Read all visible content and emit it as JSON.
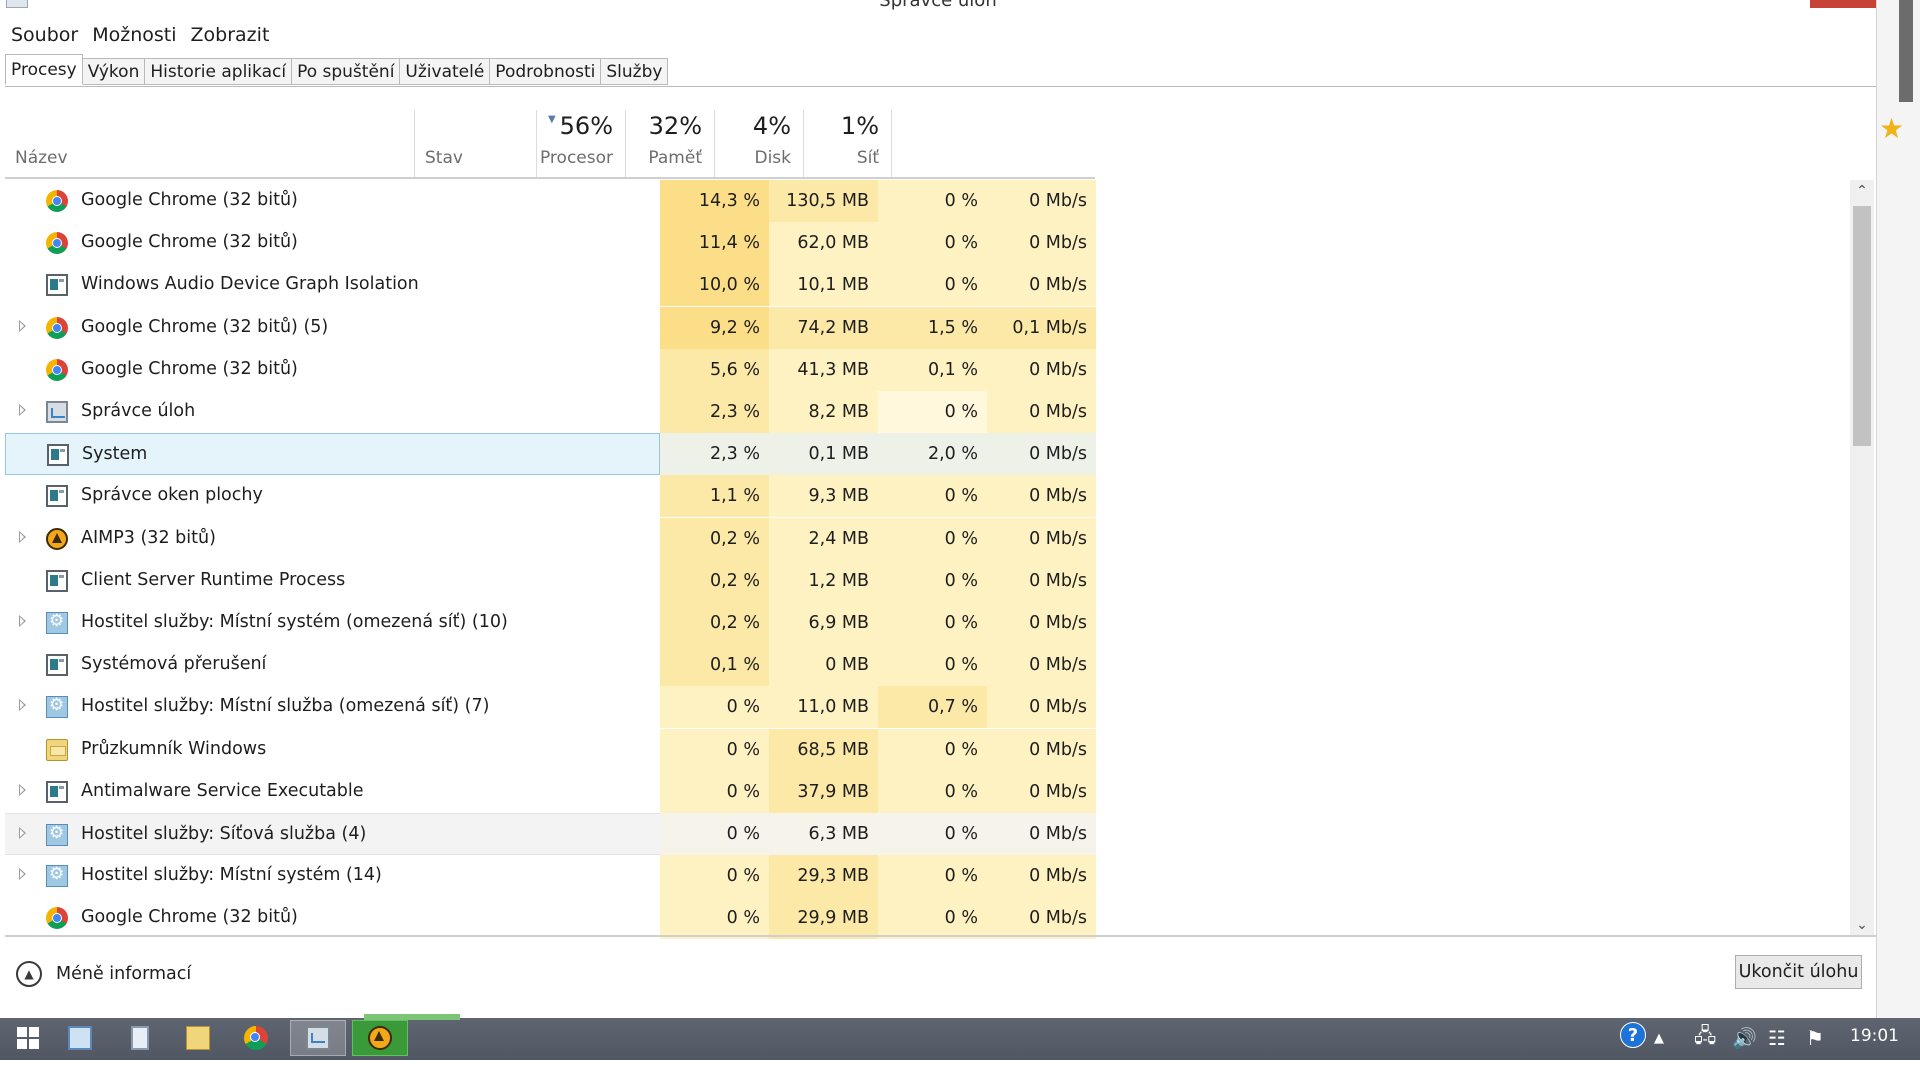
{
  "window": {
    "title": "Správce úloh"
  },
  "menu": [
    "Soubor",
    "Možnosti",
    "Zobrazit"
  ],
  "tabs": [
    {
      "label": "Procesy",
      "active": true
    },
    {
      "label": "Výkon"
    },
    {
      "label": "Historie aplikací"
    },
    {
      "label": "Po spuštění"
    },
    {
      "label": "Uživatelé"
    },
    {
      "label": "Podrobnosti"
    },
    {
      "label": "Služby"
    }
  ],
  "columns": {
    "name": {
      "label": "Název"
    },
    "status": {
      "label": "Stav"
    },
    "cpu": {
      "label": "Procesor",
      "total": "56%"
    },
    "memory": {
      "label": "Paměť",
      "total": "32%"
    },
    "disk": {
      "label": "Disk",
      "total": "4%"
    },
    "network": {
      "label": "Síť",
      "total": "1%"
    }
  },
  "heat_colors": {
    "strong": "#fdde88",
    "medium": "#fce9a7",
    "light": "#fff2c2",
    "none": "#fff8dc",
    "selected": "#eef1e8",
    "hover": "#f5f3ea"
  },
  "processes": [
    {
      "name": "Google Chrome (32 bitů)",
      "icon": "chrome-icon",
      "expandable": false,
      "cpu": "14,3 %",
      "memory": "130,5 MB",
      "disk": "0 %",
      "network": "0 Mb/s",
      "heat": [
        "strong",
        "medium",
        "light",
        "light"
      ]
    },
    {
      "name": "Google Chrome (32 bitů)",
      "icon": "chrome-icon",
      "expandable": false,
      "cpu": "11,4 %",
      "memory": "62,0 MB",
      "disk": "0 %",
      "network": "0 Mb/s",
      "heat": [
        "strong",
        "light",
        "light",
        "light"
      ]
    },
    {
      "name": "Windows Audio Device Graph Isolation",
      "icon": "window-app-icon",
      "expandable": false,
      "cpu": "10,0 %",
      "memory": "10,1 MB",
      "disk": "0 %",
      "network": "0 Mb/s",
      "heat": [
        "strong",
        "light",
        "light",
        "light"
      ]
    },
    {
      "name": "Google Chrome (32 bitů) (5)",
      "icon": "chrome-icon",
      "expandable": true,
      "cpu": "9,2 %",
      "memory": "74,2 MB",
      "disk": "1,5 %",
      "network": "0,1 Mb/s",
      "heat": [
        "strong",
        "medium",
        "medium",
        "medium"
      ]
    },
    {
      "name": "Google Chrome (32 bitů)",
      "icon": "chrome-icon",
      "expandable": false,
      "cpu": "5,6 %",
      "memory": "41,3 MB",
      "disk": "0,1 %",
      "network": "0 Mb/s",
      "heat": [
        "medium",
        "light",
        "light",
        "light"
      ]
    },
    {
      "name": "Správce úloh",
      "icon": "task-manager-icon",
      "expandable": true,
      "cpu": "2,3 %",
      "memory": "8,2 MB",
      "disk": "0 %",
      "network": "0 Mb/s",
      "heat": [
        "medium",
        "light",
        "none",
        "light"
      ]
    },
    {
      "name": "System",
      "icon": "window-app-icon",
      "expandable": false,
      "selected": true,
      "cpu": "2,3 %",
      "memory": "0,1 MB",
      "disk": "2,0 %",
      "network": "0 Mb/s",
      "heat": [
        "selected",
        "selected",
        "selected",
        "selected"
      ]
    },
    {
      "name": "Správce oken plochy",
      "icon": "window-app-icon",
      "expandable": false,
      "cpu": "1,1 %",
      "memory": "9,3 MB",
      "disk": "0 %",
      "network": "0 Mb/s",
      "heat": [
        "medium",
        "light",
        "light",
        "light"
      ]
    },
    {
      "name": "AIMP3 (32 bitů)",
      "icon": "aimp-icon",
      "expandable": true,
      "cpu": "0,2 %",
      "memory": "2,4 MB",
      "disk": "0 %",
      "network": "0 Mb/s",
      "heat": [
        "medium",
        "light",
        "light",
        "light"
      ]
    },
    {
      "name": "Client Server Runtime Process",
      "icon": "window-app-icon",
      "expandable": false,
      "cpu": "0,2 %",
      "memory": "1,2 MB",
      "disk": "0 %",
      "network": "0 Mb/s",
      "heat": [
        "medium",
        "light",
        "light",
        "light"
      ]
    },
    {
      "name": "Hostitel služby: Místní systém (omezená síť) (10)",
      "icon": "service-host-icon",
      "expandable": true,
      "cpu": "0,2 %",
      "memory": "6,9 MB",
      "disk": "0 %",
      "network": "0 Mb/s",
      "heat": [
        "medium",
        "light",
        "light",
        "light"
      ]
    },
    {
      "name": "Systémová přerušení",
      "icon": "window-app-icon",
      "expandable": false,
      "cpu": "0,1 %",
      "memory": "0 MB",
      "disk": "0 %",
      "network": "0 Mb/s",
      "heat": [
        "medium",
        "light",
        "light",
        "light"
      ]
    },
    {
      "name": "Hostitel služby: Místní služba (omezená síť) (7)",
      "icon": "service-host-icon",
      "expandable": true,
      "cpu": "0 %",
      "memory": "11,0 MB",
      "disk": "0,7 %",
      "network": "0 Mb/s",
      "heat": [
        "light",
        "light",
        "medium",
        "light"
      ]
    },
    {
      "name": "Průzkumník Windows",
      "icon": "explorer-icon",
      "expandable": false,
      "cpu": "0 %",
      "memory": "68,5 MB",
      "disk": "0 %",
      "network": "0 Mb/s",
      "heat": [
        "light",
        "medium",
        "light",
        "light"
      ]
    },
    {
      "name": "Antimalware Service Executable",
      "icon": "window-app-icon",
      "expandable": true,
      "cpu": "0 %",
      "memory": "37,9 MB",
      "disk": "0 %",
      "network": "0 Mb/s",
      "heat": [
        "light",
        "medium",
        "light",
        "light"
      ]
    },
    {
      "name": "Hostitel služby: Síťová služba (4)",
      "icon": "service-host-icon",
      "expandable": true,
      "hover": true,
      "cpu": "0 %",
      "memory": "6,3 MB",
      "disk": "0 %",
      "network": "0 Mb/s",
      "heat": [
        "hover",
        "hover",
        "hover",
        "hover"
      ]
    },
    {
      "name": "Hostitel služby: Místní systém (14)",
      "icon": "service-host-icon",
      "expandable": true,
      "cpu": "0 %",
      "memory": "29,3 MB",
      "disk": "0 %",
      "network": "0 Mb/s",
      "heat": [
        "light",
        "medium",
        "light",
        "light"
      ]
    },
    {
      "name": "Google Chrome (32 bitů)",
      "icon": "chrome-icon",
      "expandable": false,
      "cpu": "0 %",
      "memory": "29,9 MB",
      "disk": "0 %",
      "network": "0 Mb/s",
      "heat": [
        "light",
        "medium",
        "light",
        "light"
      ]
    }
  ],
  "footer": {
    "fewer_details": "Méně informací",
    "end_task": "Ukončit úlohu"
  },
  "taskbar": {
    "clock": "19:01",
    "pinned": [
      "start-icon",
      "photo-app-icon",
      "calculator-icon",
      "file-explorer-icon",
      "chrome-icon",
      "task-manager-icon",
      "aimp-icon"
    ],
    "tray": [
      "help-icon",
      "tray-chevron-icon",
      "network-icon",
      "volume-icon",
      "usb-icon",
      "flag-icon"
    ]
  }
}
